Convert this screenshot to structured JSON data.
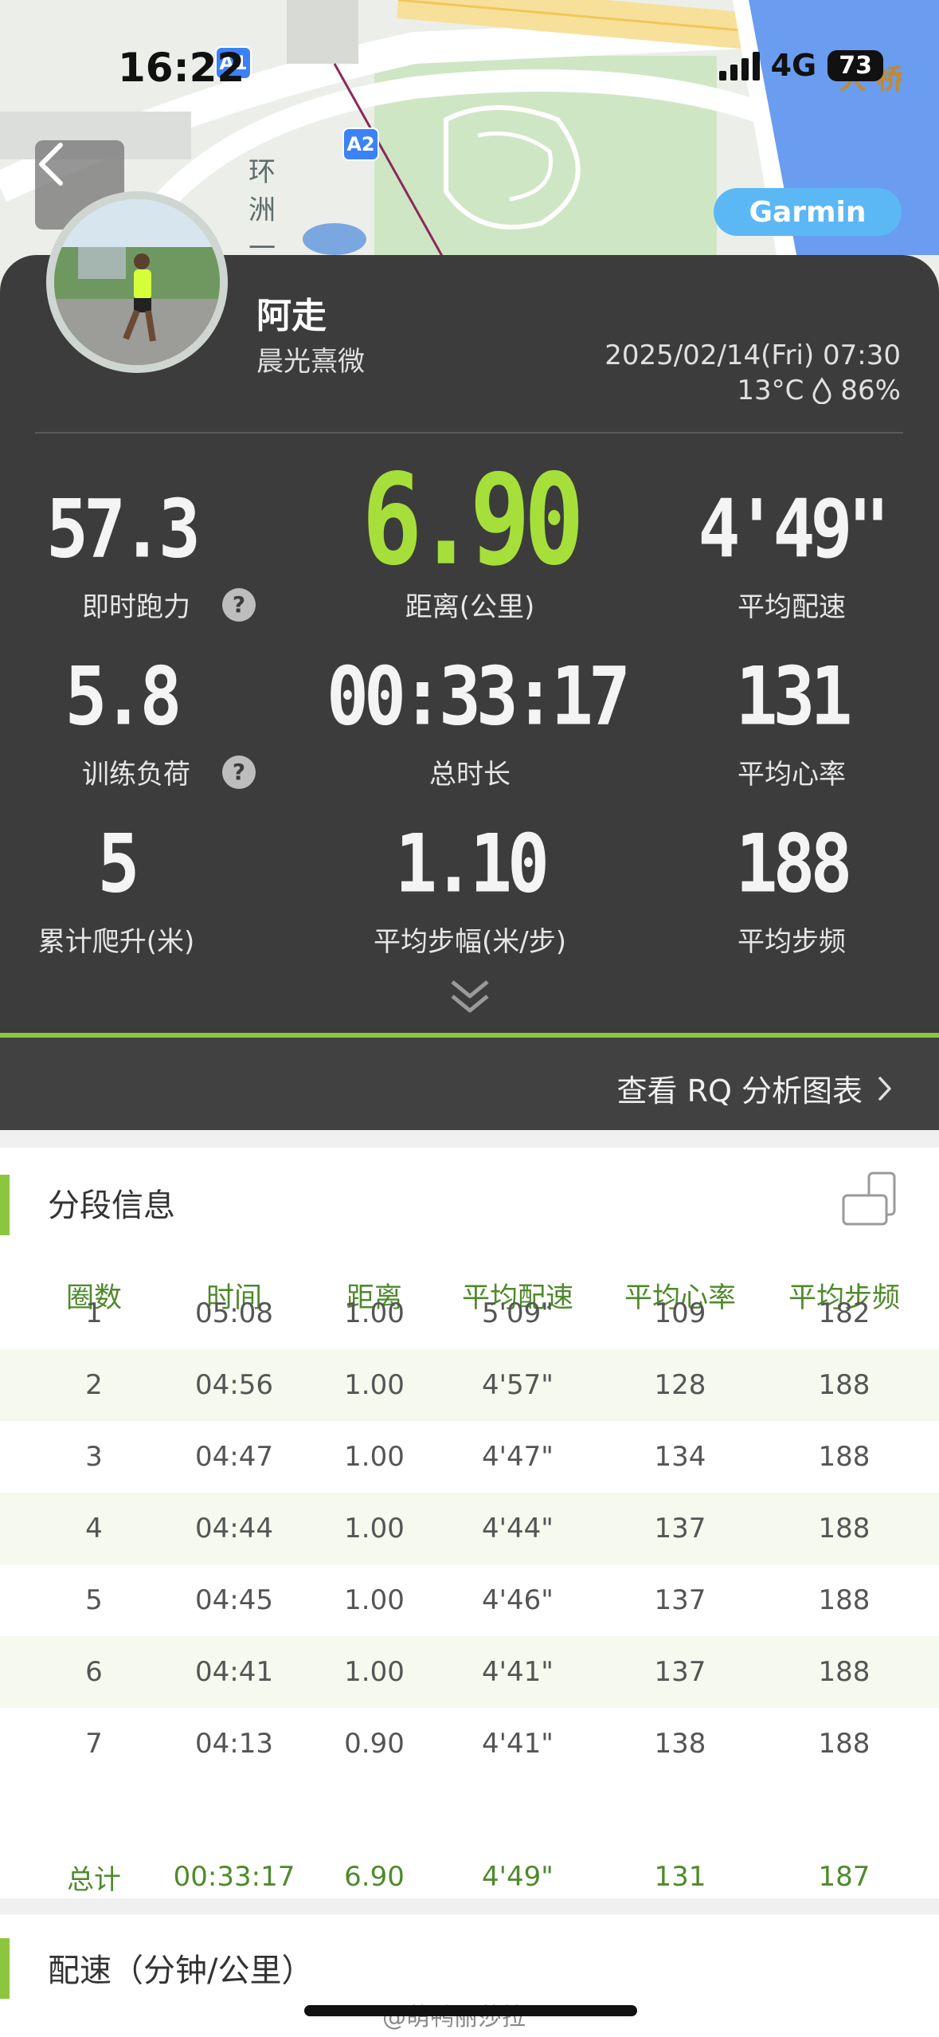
{
  "status_bar": {
    "time": "16:22",
    "network": "4G",
    "battery": "73"
  },
  "map": {
    "labels": [
      "环",
      "洲",
      "一"
    ],
    "place": "大 桥",
    "badges": [
      "A1",
      "A2"
    ],
    "source_pill": "Garmin"
  },
  "profile": {
    "name": "阿走",
    "subtitle": "晨光熹微",
    "datetime": "2025/02/14(Fri) 07:30",
    "temperature": "13°C",
    "humidity": "86%"
  },
  "stats": {
    "power": {
      "value": "57.3",
      "label": "即时跑力"
    },
    "distance": {
      "value": "6.90",
      "label": "距离(公里)"
    },
    "pace": {
      "value": "4'49\"",
      "label": "平均配速"
    },
    "load": {
      "value": "5.8",
      "label": "训练负荷"
    },
    "duration": {
      "value": "00:33:17",
      "label": "总时长"
    },
    "heart_rate": {
      "value": "131",
      "label": "平均心率"
    },
    "ascent": {
      "value": "5",
      "label": "累计爬升(米)"
    },
    "stride": {
      "value": "1.10",
      "label": "平均步幅(米/步)"
    },
    "cadence": {
      "value": "188",
      "label": "平均步频"
    }
  },
  "rq_link": "查看 RQ 分析图表",
  "splits": {
    "title": "分段信息",
    "headers": [
      "圈数",
      "时间",
      "距离",
      "平均配速",
      "平均心率",
      "平均步频"
    ],
    "rows": [
      [
        "1",
        "05:08",
        "1.00",
        "5'09\"",
        "109",
        "182"
      ],
      [
        "2",
        "04:56",
        "1.00",
        "4'57\"",
        "128",
        "188"
      ],
      [
        "3",
        "04:47",
        "1.00",
        "4'47\"",
        "134",
        "188"
      ],
      [
        "4",
        "04:44",
        "1.00",
        "4'44\"",
        "137",
        "188"
      ],
      [
        "5",
        "04:45",
        "1.00",
        "4'46\"",
        "137",
        "188"
      ],
      [
        "6",
        "04:41",
        "1.00",
        "4'41\"",
        "137",
        "188"
      ],
      [
        "7",
        "04:13",
        "0.90",
        "4'41\"",
        "138",
        "188"
      ]
    ],
    "total": [
      "总计",
      "00:33:17",
      "6.90",
      "4'49\"",
      "131",
      "187"
    ]
  },
  "pace_section": {
    "title": "配速（分钟/公里）"
  },
  "watermark": "@萌鸭丽莎拉",
  "colors": {
    "accent_green": "#8cc63f",
    "distance_green": "#a6df3a",
    "table_green": "#4e8a2c",
    "card": "#3c3c3c",
    "garmin_blue": "#5bb8f5"
  }
}
